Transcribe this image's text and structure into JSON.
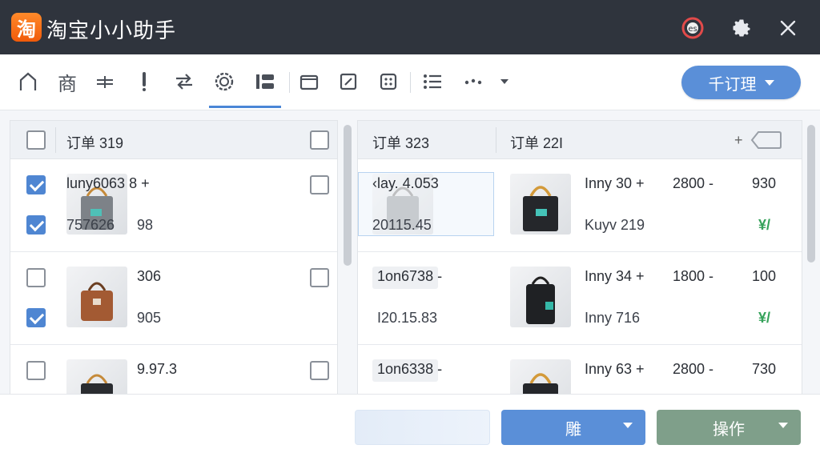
{
  "app": {
    "logo_char": "淘",
    "title": "淘宝小小助手"
  },
  "titlebar": {
    "icons": [
      "support-icon",
      "gear-icon",
      "close-icon"
    ]
  },
  "toolbar": {
    "tools": [
      "home-icon",
      "goods-icon",
      "filter-icon",
      "flag-icon",
      "sync-icon",
      "settings-ring-icon",
      "list-bars-icon",
      "folder-icon",
      "edit-icon",
      "grid-icon",
      "bullet-list-icon",
      "more-icon"
    ],
    "goods_label": "商",
    "manage_label": "千订理"
  },
  "left_panel": {
    "header_label": "订单 319",
    "rows": [
      {
        "line1": "luny6063  8  +",
        "line2": "757626",
        "line2b": "98",
        "checked_a": true,
        "checked_b": true
      },
      {
        "line1": "306",
        "line2": "905",
        "checked_a": false,
        "checked_b": true
      },
      {
        "line1": "9.97.3",
        "line2": "",
        "checked_a": false,
        "checked_b": false
      }
    ]
  },
  "right_panel": {
    "header_left": "订单 323",
    "header_right": "订单 22I",
    "header_plus": "+",
    "rows": [
      {
        "code": "‹lay. 4.053",
        "date": "20115.45",
        "name": "Inny 30  +",
        "price": "2800  -",
        "qty": "930",
        "sub": "Kuyv 219",
        "mark": "¥/"
      },
      {
        "code": "1on6738  -",
        "date": "I20.15.83",
        "name": "Inny 34  +",
        "price": "1800  -",
        "qty": "100",
        "sub": "Inny 716",
        "mark": "¥/"
      },
      {
        "code": "1on6338  -",
        "date": "",
        "name": "Inny 63  +",
        "price": "2800  -",
        "qty": "730",
        "sub": "",
        "mark": ""
      }
    ]
  },
  "footer": {
    "btn_primary": "雕",
    "btn_action": "操作"
  },
  "colors": {
    "titlebar": "#2f343d",
    "accent": "#5a8fd8",
    "action": "#7f9f8a",
    "logo": "#f26a12",
    "ok": "#35a25a"
  }
}
